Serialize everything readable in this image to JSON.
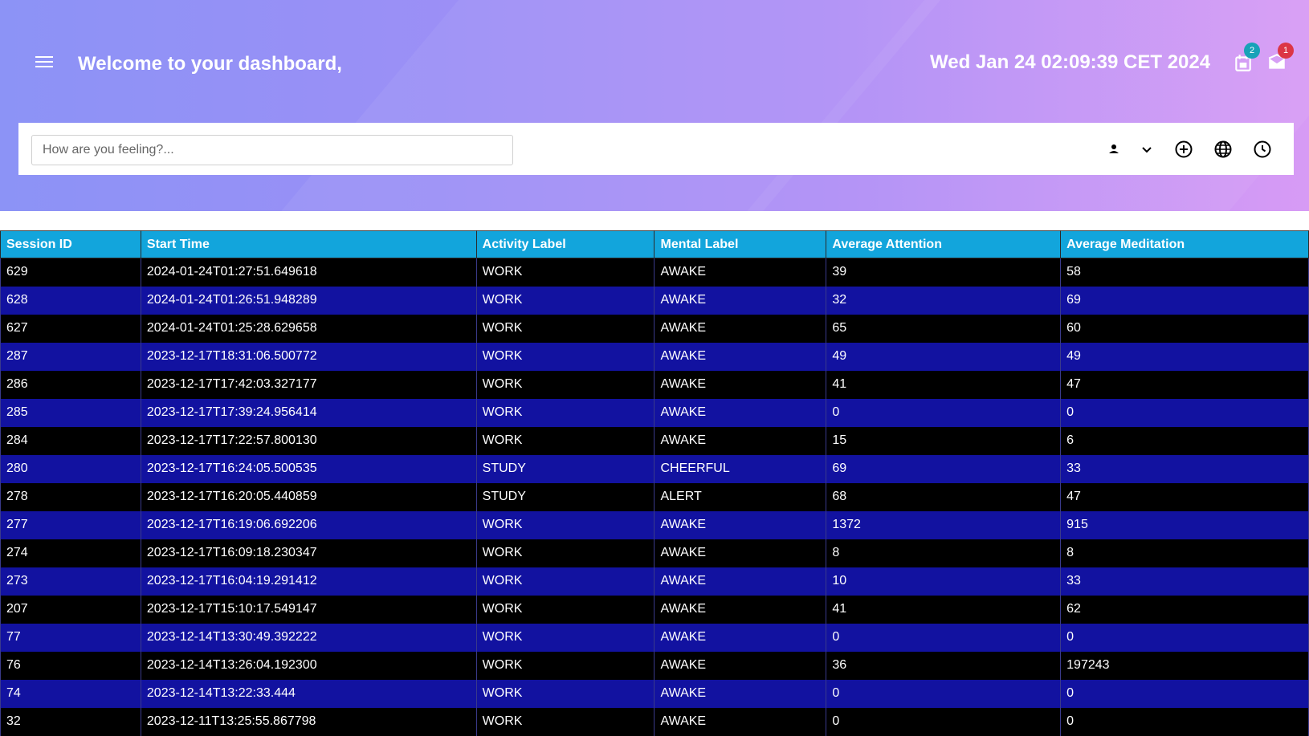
{
  "header": {
    "welcome": "Welcome to your dashboard,",
    "datetime": "Wed Jan 24 02:09:39 CET 2024",
    "notifications_badge": "2",
    "messages_badge": "1"
  },
  "colors": {
    "table_header": "#12a5dc",
    "row_dark": "#000000",
    "row_blue": "#1212a0",
    "badge_teal": "#17a2b8",
    "badge_red": "#dc3545"
  },
  "toolbar": {
    "feeling_placeholder": "How are you feeling?...",
    "icons": [
      "person-icon",
      "chevron-down-icon",
      "add-circle-icon",
      "globe-icon",
      "clock-icon"
    ]
  },
  "table": {
    "columns": [
      "Session ID",
      "Start Time",
      "Activity Label",
      "Mental Label",
      "Average Attention",
      "Average Meditation"
    ],
    "rows": [
      [
        "629",
        "2024-01-24T01:27:51.649618",
        "WORK",
        "AWAKE",
        "39",
        "58"
      ],
      [
        "628",
        "2024-01-24T01:26:51.948289",
        "WORK",
        "AWAKE",
        "32",
        "69"
      ],
      [
        "627",
        "2024-01-24T01:25:28.629658",
        "WORK",
        "AWAKE",
        "65",
        "60"
      ],
      [
        "287",
        "2023-12-17T18:31:06.500772",
        "WORK",
        "AWAKE",
        "49",
        "49"
      ],
      [
        "286",
        "2023-12-17T17:42:03.327177",
        "WORK",
        "AWAKE",
        "41",
        "47"
      ],
      [
        "285",
        "2023-12-17T17:39:24.956414",
        "WORK",
        "AWAKE",
        "0",
        "0"
      ],
      [
        "284",
        "2023-12-17T17:22:57.800130",
        "WORK",
        "AWAKE",
        "15",
        "6"
      ],
      [
        "280",
        "2023-12-17T16:24:05.500535",
        "STUDY",
        "CHEERFUL",
        "69",
        "33"
      ],
      [
        "278",
        "2023-12-17T16:20:05.440859",
        "STUDY",
        "ALERT",
        "68",
        "47"
      ],
      [
        "277",
        "2023-12-17T16:19:06.692206",
        "WORK",
        "AWAKE",
        "1372",
        "915"
      ],
      [
        "274",
        "2023-12-17T16:09:18.230347",
        "WORK",
        "AWAKE",
        "8",
        "8"
      ],
      [
        "273",
        "2023-12-17T16:04:19.291412",
        "WORK",
        "AWAKE",
        "10",
        "33"
      ],
      [
        "207",
        "2023-12-17T15:10:17.549147",
        "WORK",
        "AWAKE",
        "41",
        "62"
      ],
      [
        "77",
        "2023-12-14T13:30:49.392222",
        "WORK",
        "AWAKE",
        "0",
        "0"
      ],
      [
        "76",
        "2023-12-14T13:26:04.192300",
        "WORK",
        "AWAKE",
        "36",
        "197243"
      ],
      [
        "74",
        "2023-12-14T13:22:33.444",
        "WORK",
        "AWAKE",
        "0",
        "0"
      ],
      [
        "32",
        "2023-12-11T13:25:55.867798",
        "WORK",
        "AWAKE",
        "0",
        "0"
      ]
    ]
  }
}
